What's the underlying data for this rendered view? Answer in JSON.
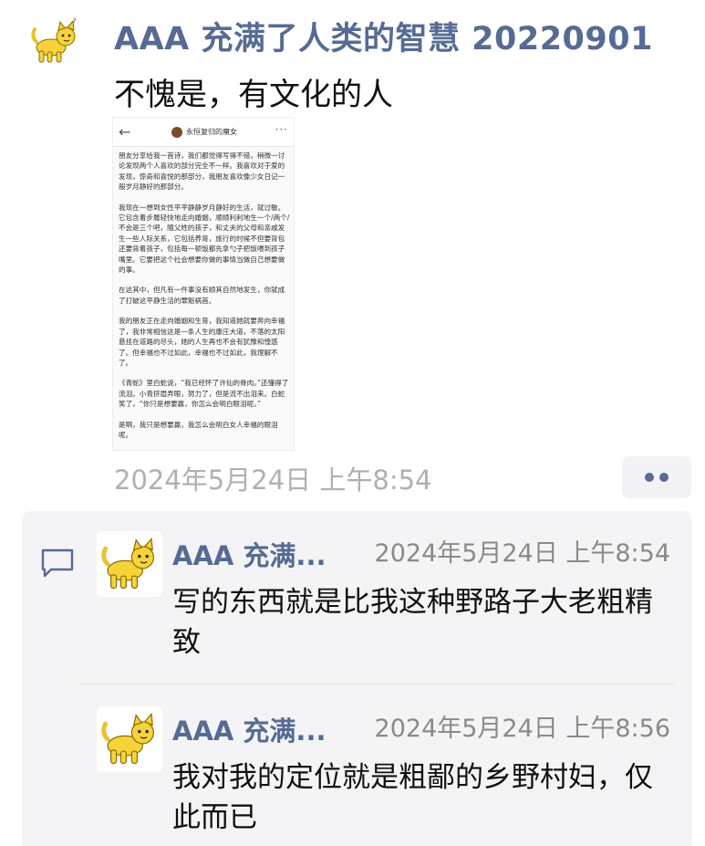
{
  "post": {
    "author": "AAA 充满了人类的智慧 20220901",
    "text": "不愧是，有文化的人",
    "timestamp": "2024年5月24日 上午8:54",
    "avatar_icon": "yellow-cat-icon",
    "screenshot": {
      "title": "永恒复归的魔女",
      "paragraphs": [
        "朋友分享给我一首诗，我们都觉得写得不错，稍微一讨论发现两个人喜欢的部分完全不一样。我喜欢对于爱的发现，惊奇和喜悦的那部分，我朋友喜欢像少女日记一般岁月静好的那部分。",
        "我现在一想到女性平平静静岁月静好的生活，就过敏。它包含着步履轻快地走向婚姻，顺顺利利地生一个/两个/不会是三个吧，随父姓的孩子，和丈夫的父母和亲戚发生一些人际关系，它包括养育，旅行的时候不但要背包还要背着孩子，包括每一顿饭都先拿勺子把饭喂到孩子嘴里。它要把这个社会想要你做的事情当做自己想要做的事。",
        "在这其中，但凡有一件事没有顺其自然地发生，你就成了打破这平静生活的罪魁祸首。",
        "我的朋友正在走向婚姻和生育，我知道她就要奔向幸福了，我非常相信这是一条人生的康庄大道，不落的太阳悬挂在道路的尽头，她的人生再也不会有犹豫和惶惑了。但幸福也不过如此，幸福也不过如此，我理解不了。",
        "《青蛇》里白蛇说，“我已经怀了许仙的骨肉。”还懂得了流泪。小青挤眉弄眼，努力了，但是流不出泪来。白蛇笑了，“你只是想要赢，你怎么会明白眼泪呢。”",
        "是啊，我只是想要赢，我怎么会明白女人幸福的眼泪呢。"
      ]
    }
  },
  "comments": [
    {
      "author": "AAA 充满...",
      "time": "2024年5月24日 上午8:54",
      "text": "写的东西就是比我这种野路子大老粗精致"
    },
    {
      "author": "AAA 充满...",
      "time": "2024年5月24日 上午8:56",
      "text": "我对我的定位就是粗鄙的乡野村妇，仅此而已"
    }
  ],
  "colors": {
    "name_blue": "#566b94",
    "timestamp_gray": "#b0b0b0",
    "comment_bg": "#f4f4f6"
  }
}
